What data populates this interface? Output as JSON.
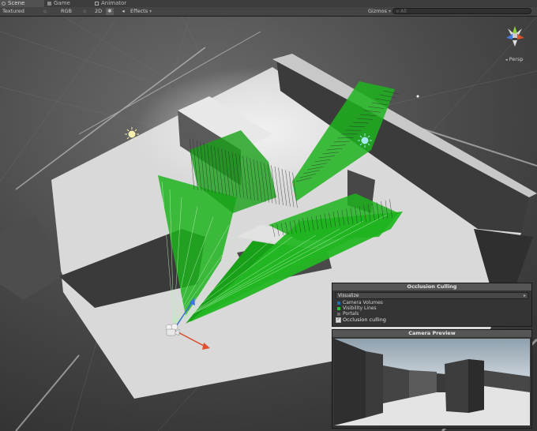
{
  "tabs": [
    {
      "label": "Scene",
      "icon": "scene-icon"
    },
    {
      "label": "Game",
      "icon": "game-icon"
    },
    {
      "label": "Animator",
      "icon": "animator-icon"
    }
  ],
  "toolbar": {
    "render_mode": "Textured",
    "color_mode": "RGB",
    "toggle_2d": "2D",
    "effects": "Effects",
    "gizmos": "Gizmos",
    "search_placeholder": "All"
  },
  "gizmo": {
    "projection": "Persp"
  },
  "occlusion_panel": {
    "title": "Occlusion Culling",
    "visualize_label": "Visualize",
    "items": [
      {
        "label": "Camera Volumes",
        "color": "#2b6fa8"
      },
      {
        "label": "Visibility Lines",
        "color": "#2ec12e"
      },
      {
        "label": "Portals",
        "color": "#6a6a6a"
      }
    ],
    "checkbox_label": "Occlusion culling",
    "checkbox_checked": true
  },
  "preview_panel": {
    "title": "Camera Preview"
  },
  "colors": {
    "visibility_green": "#1fb31f",
    "floor": "#ddd"
  }
}
